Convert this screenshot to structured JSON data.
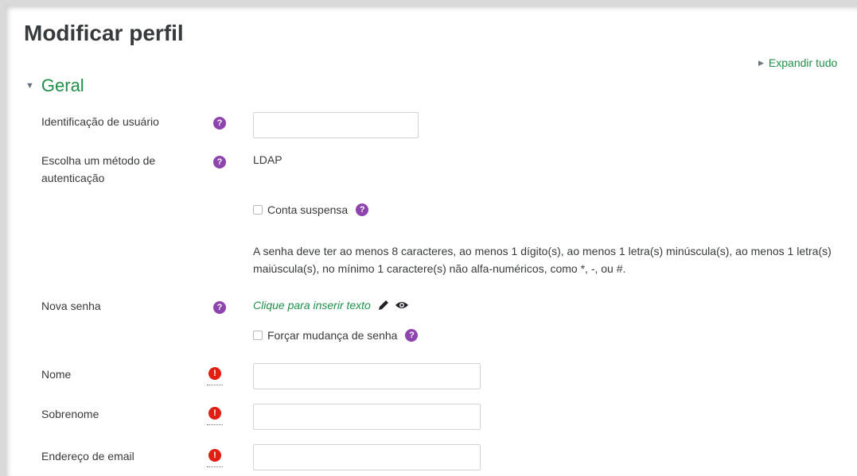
{
  "page": {
    "title": "Modificar perfil",
    "expand_all": "Expandir tudo",
    "accent_color": "#1f8f4a",
    "help_icon_color": "#8e44ad",
    "required_icon_color": "#e21d12"
  },
  "section": {
    "title": "Geral",
    "icon": "caret-down-icon"
  },
  "fields": {
    "username": {
      "label": "Identificação de usuário",
      "value": ""
    },
    "auth": {
      "label": "Escolha um método de autenticação",
      "value": "LDAP"
    },
    "suspended": {
      "label": "Conta suspensa",
      "checked": false
    },
    "password_policy": "A senha deve ter ao menos 8 caracteres, ao menos 1 dígito(s), ao menos 1 letra(s) minúscula(s), ao menos 1 letra(s) maiúscula(s), no mínimo 1 caractere(s) não alfa-numéricos, como *, -, ou #.",
    "new_password": {
      "label": "Nova senha",
      "placeholder_link": "Clique para inserir texto"
    },
    "force_change": {
      "label": "Forçar mudança de senha",
      "checked": false
    },
    "firstname": {
      "label": "Nome",
      "value": ""
    },
    "lastname": {
      "label": "Sobrenome",
      "value": ""
    },
    "email": {
      "label": "Endereço de email",
      "value": ""
    }
  },
  "icons": {
    "help": "question-circle-icon",
    "required": "exclamation-circle-icon",
    "edit": "pencil-icon",
    "reveal": "eye-icon",
    "expand": "caret-right-icon"
  }
}
